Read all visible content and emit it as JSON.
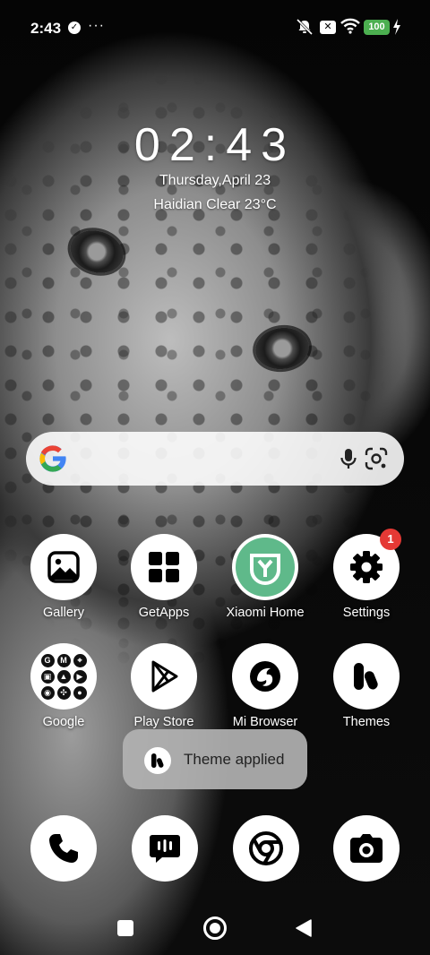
{
  "status_bar": {
    "time": "2:43",
    "check_glyph": "✓",
    "more_glyph": "···",
    "sim_glyph": "✕",
    "battery": "100",
    "icons": [
      "check-circle-icon",
      "more-dots-icon",
      "muted-bell-icon",
      "sim-x-icon",
      "wifi-icon",
      "battery-icon",
      "charging-bolt-icon"
    ]
  },
  "clock_widget": {
    "time": "02:43",
    "date": "Thursday,April 23",
    "weather": "Haidian Clear 23°C"
  },
  "search_bar": {
    "icons": [
      "google-g-icon",
      "microphone-icon",
      "google-lens-icon"
    ]
  },
  "apps": {
    "gallery": {
      "label": "Gallery",
      "icon": "gallery-icon"
    },
    "getapps": {
      "label": "GetApps",
      "icon": "getapps-grid-icon"
    },
    "xiaomi_home": {
      "label": "Xiaomi Home",
      "icon": "xiaomi-home-icon",
      "color": "#5fb98a"
    },
    "settings": {
      "label": "Settings",
      "icon": "gear-icon",
      "badge": "1",
      "badge_color": "#e53935"
    },
    "google": {
      "label": "Google",
      "icon": "google-folder-icon",
      "folder_glyphs": [
        "G",
        "M",
        "⌖",
        "▣",
        "▲",
        "▶",
        "◉",
        "✣",
        "●"
      ]
    },
    "play_store": {
      "label": "Play Store",
      "icon": "play-store-icon"
    },
    "mi_browser": {
      "label": "Mi Browser",
      "icon": "mi-browser-icon"
    },
    "themes": {
      "label": "Themes",
      "icon": "themes-icon"
    }
  },
  "toast": {
    "text": "Theme applied",
    "icon": "themes-icon"
  },
  "dock": [
    "phone-icon",
    "messages-icon",
    "chrome-icon",
    "camera-icon"
  ],
  "nav_bar": [
    "recents-button",
    "home-button",
    "back-button"
  ]
}
